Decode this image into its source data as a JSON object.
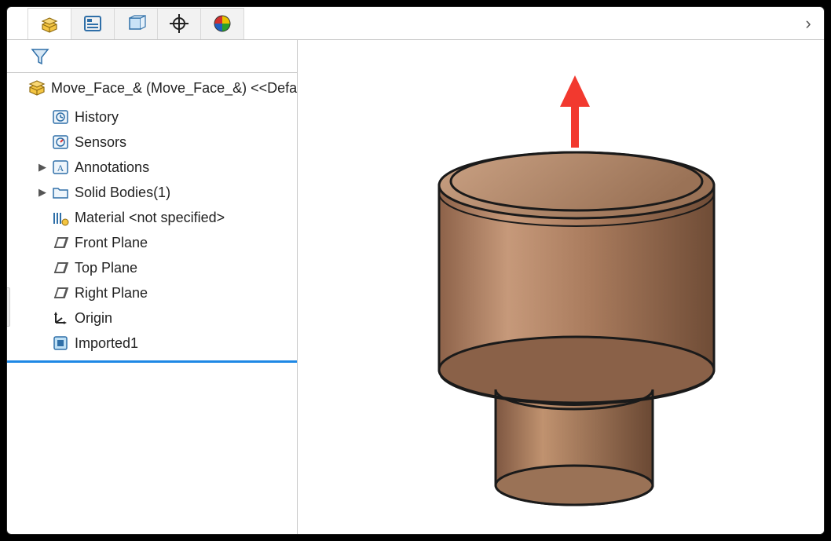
{
  "toolbar": {
    "more": "›"
  },
  "tree": {
    "root_label": "Move_Face_& (Move_Face_&) <<Default",
    "items": [
      {
        "label": "History",
        "expandable": false,
        "icon": "history"
      },
      {
        "label": "Sensors",
        "expandable": false,
        "icon": "sensors"
      },
      {
        "label": "Annotations",
        "expandable": true,
        "icon": "annotations"
      },
      {
        "label": "Solid Bodies(1)",
        "expandable": true,
        "icon": "folder"
      },
      {
        "label": "Material <not specified>",
        "expandable": false,
        "icon": "material"
      },
      {
        "label": "Front Plane",
        "expandable": false,
        "icon": "plane"
      },
      {
        "label": "Top Plane",
        "expandable": false,
        "icon": "plane"
      },
      {
        "label": "Right Plane",
        "expandable": false,
        "icon": "plane"
      },
      {
        "label": "Origin",
        "expandable": false,
        "icon": "origin"
      },
      {
        "label": "Imported1",
        "expandable": false,
        "icon": "imported"
      }
    ]
  },
  "viewport": {
    "arrow_color": "#f2392f"
  }
}
